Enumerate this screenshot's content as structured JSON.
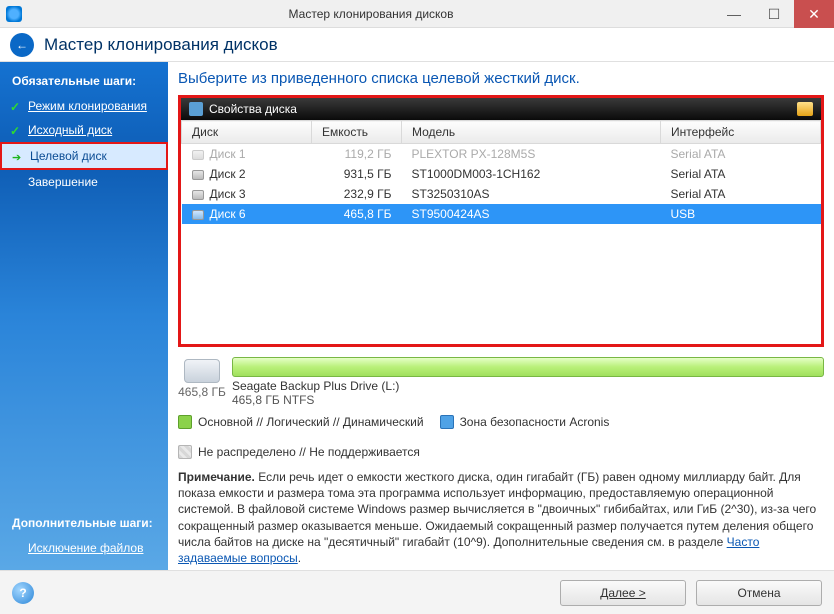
{
  "window": {
    "title": "Мастер клонирования дисков"
  },
  "header": {
    "title": "Мастер клонирования дисков"
  },
  "sidebar": {
    "heading_required": "Обязательные шаги:",
    "steps": [
      {
        "label": "Режим клонирования",
        "status": "done"
      },
      {
        "label": "Исходный диск",
        "status": "done"
      },
      {
        "label": "Целевой диск",
        "status": "current"
      },
      {
        "label": "Завершение",
        "status": "pending"
      }
    ],
    "heading_optional": "Дополнительные шаги:",
    "optional": [
      {
        "label": "Исключение файлов"
      }
    ]
  },
  "main": {
    "heading": "Выберите из приведенного списка целевой жесткий диск.",
    "panel_title": "Свойства диска",
    "columns": {
      "disk": "Диск",
      "capacity": "Емкость",
      "model": "Модель",
      "interface": "Интерфейс"
    },
    "rows": [
      {
        "disk": "Диск 1",
        "capacity": "119,2 ГБ",
        "model": "PLEXTOR PX-128M5S",
        "interface": "Serial ATA",
        "state": "disabled"
      },
      {
        "disk": "Диск 2",
        "capacity": "931,5 ГБ",
        "model": "ST1000DM003-1CH162",
        "interface": "Serial ATA",
        "state": "normal"
      },
      {
        "disk": "Диск 3",
        "capacity": "232,9 ГБ",
        "model": "ST3250310AS",
        "interface": "Serial ATA",
        "state": "normal"
      },
      {
        "disk": "Диск 6",
        "capacity": "465,8 ГБ",
        "model": "ST9500424AS",
        "interface": "USB",
        "state": "selected"
      }
    ],
    "partition": {
      "total": "465,8 ГБ",
      "name": "Seagate Backup Plus Drive (L:)",
      "detail": "465,8 ГБ  NTFS"
    },
    "legend": {
      "primary": "Основной // Логический // Динамический",
      "secure": "Зона безопасности Acronis",
      "unalloc": "Не распределено // Не поддерживается"
    },
    "note_label": "Примечание.",
    "note_text": " Если речь идет о емкости жесткого диска, один гигабайт (ГБ) равен одному миллиарду байт. Для показа емкости и размера тома эта программа использует информацию, предоставляемую операционной системой. В файловой системе Windows размер вычисляется в \"двоичных\" гибибайтах, или ГиБ (2^30), из-за чего сокращенный размер оказывается меньше. Ожидаемый сокращенный размер получается путем деления общего числа байтов на диске на \"десятичный\" гигабайт (10^9). Дополнительные сведения см. в разделе ",
    "note_link": "Часто задаваемые вопросы",
    "note_after": "."
  },
  "footer": {
    "next": "Далее >",
    "cancel": "Отмена"
  }
}
